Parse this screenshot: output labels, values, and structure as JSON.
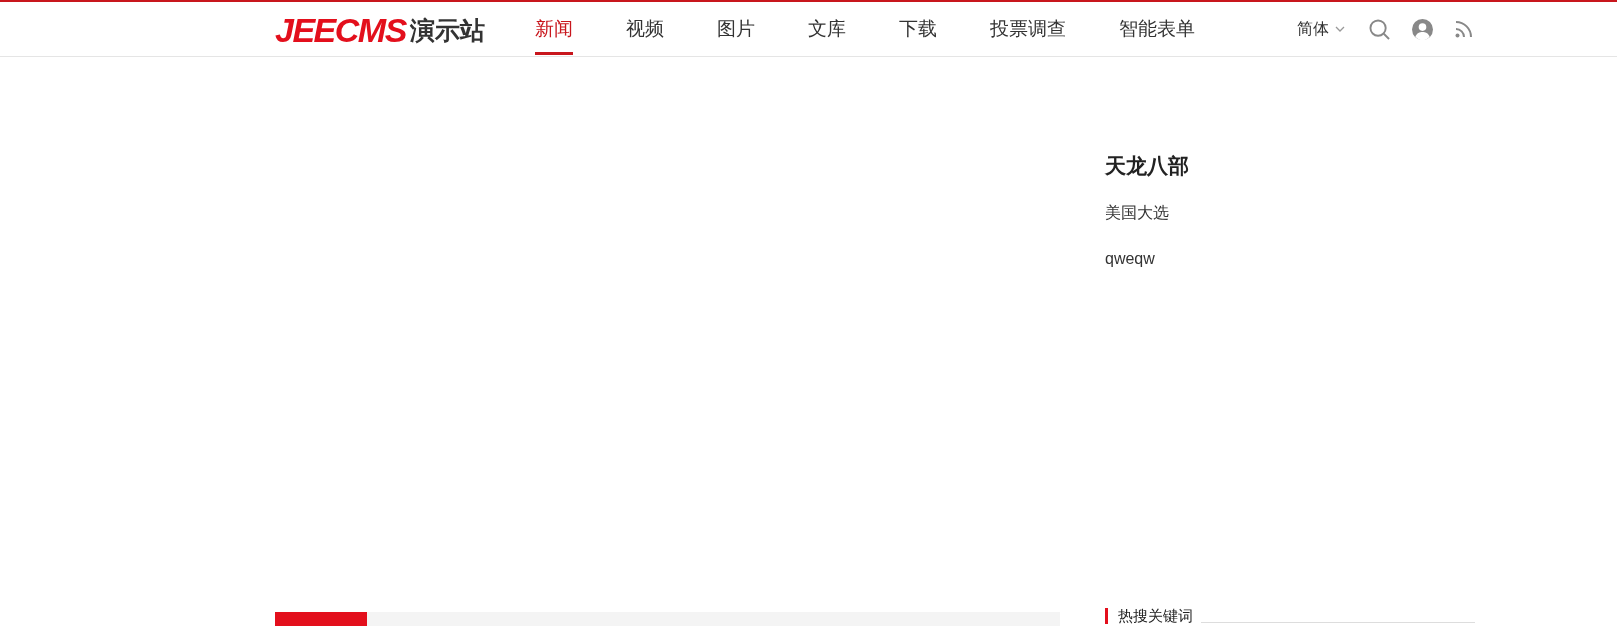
{
  "header": {
    "logo": {
      "brand": "JEECMS",
      "suffix": "演示站"
    },
    "nav": [
      {
        "label": "新闻",
        "selected": true
      },
      {
        "label": "视频",
        "selected": false
      },
      {
        "label": "图片",
        "selected": false
      },
      {
        "label": "文库",
        "selected": false
      },
      {
        "label": "下载",
        "selected": false
      },
      {
        "label": "投票调查",
        "selected": false
      },
      {
        "label": "智能表单",
        "selected": false
      }
    ],
    "language": "简体"
  },
  "featured": {
    "title": "天龙八部",
    "items": [
      "美国大选",
      "qweqw"
    ]
  },
  "sidebar": {
    "heading": "热搜关键词"
  }
}
